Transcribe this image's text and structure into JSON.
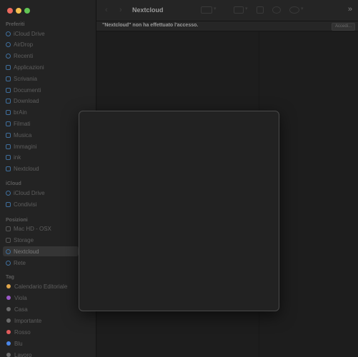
{
  "window": {
    "title": "Nextcloud"
  },
  "toolbar": {
    "more": "»"
  },
  "infobar": {
    "message": "\"Nextcloud\" non ha effettuato l'accesso.",
    "button": "Accedi..."
  },
  "sidebar": {
    "favorites_header": "Preferiti",
    "favorites": [
      {
        "label": "iCloud Drive",
        "icon": "cloud-icon"
      },
      {
        "label": "AirDrop",
        "icon": "airdrop-icon"
      },
      {
        "label": "Recenti",
        "icon": "clock-icon"
      },
      {
        "label": "Applicazioni",
        "icon": "applications-icon"
      },
      {
        "label": "Scrivania",
        "icon": "desktop-icon"
      },
      {
        "label": "Documenti",
        "icon": "document-icon"
      },
      {
        "label": "Download",
        "icon": "download-icon"
      },
      {
        "label": "brAin",
        "icon": "folder-icon"
      },
      {
        "label": "Filmati",
        "icon": "film-icon"
      },
      {
        "label": "Musica",
        "icon": "music-icon"
      },
      {
        "label": "Immagini",
        "icon": "photo-icon"
      },
      {
        "label": "ink",
        "icon": "folder-icon"
      },
      {
        "label": "Nextcloud",
        "icon": "folder-icon"
      }
    ],
    "icloud_header": "iCloud",
    "icloud": [
      {
        "label": "iCloud Drive",
        "icon": "cloud-icon"
      },
      {
        "label": "Condivisi",
        "icon": "shared-folder-icon"
      }
    ],
    "locations_header": "Posizioni",
    "locations": [
      {
        "label": "Mac HD - OSX",
        "icon": "disk-icon"
      },
      {
        "label": "Storage",
        "icon": "disk-icon"
      },
      {
        "label": "Nextcloud",
        "icon": "cloud-icon"
      },
      {
        "label": "Rete",
        "icon": "network-icon"
      }
    ],
    "tags_header": "Tag",
    "tags": [
      {
        "label": "Calendario Editoriale",
        "color": "#e0a64b"
      },
      {
        "label": "Viola",
        "color": "#9b59c8"
      },
      {
        "label": "Casa",
        "color": "#6a6a6a"
      },
      {
        "label": "Importante",
        "color": "#6a6a6a"
      },
      {
        "label": "Rosso",
        "color": "#e25c5c"
      },
      {
        "label": "Blu",
        "color": "#4a86e8"
      },
      {
        "label": "Lavoro",
        "color": "#6a6a6a"
      }
    ]
  }
}
